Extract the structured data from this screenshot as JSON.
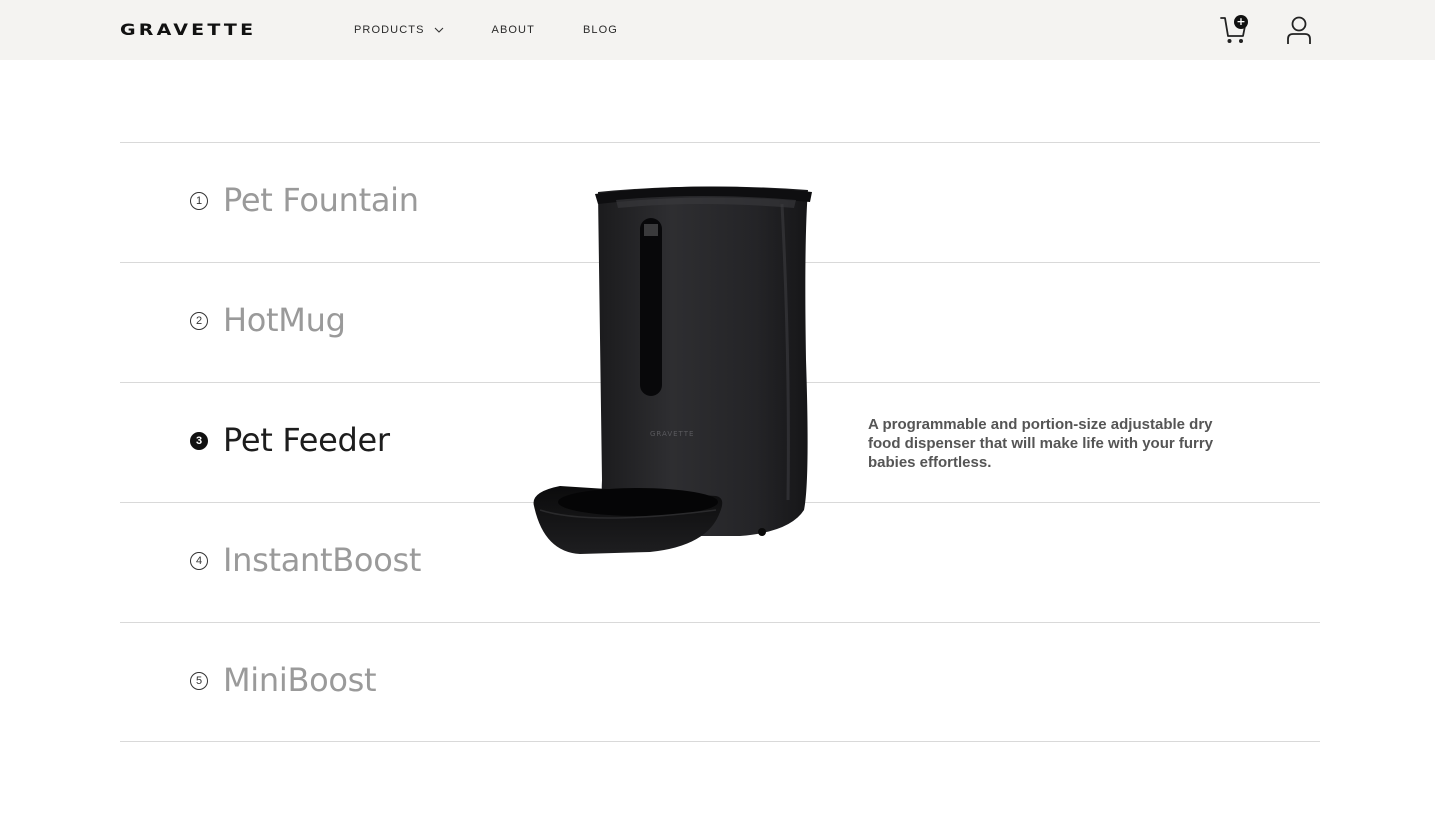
{
  "header": {
    "logo_text": "GRAVETTE",
    "nav": [
      {
        "label": "PRODUCTS"
      },
      {
        "label": "ABOUT"
      },
      {
        "label": "BLOG"
      }
    ],
    "cart_badge": "+"
  },
  "products": [
    {
      "number": "1",
      "name": "Pet Fountain"
    },
    {
      "number": "2",
      "name": "HotMug"
    },
    {
      "number": "3",
      "name": "Pet Feeder",
      "description": "A programmable and portion-size adjustable dry food dispenser that will make life with your furry babies effortless."
    },
    {
      "number": "4",
      "name": "InstantBoost"
    },
    {
      "number": "5",
      "name": "MiniBoost"
    }
  ],
  "active_product": "Pet Feeder",
  "product_image_label": "GRAVETTE",
  "colors": {
    "header_bg": "#f4f3f1",
    "divider": "#d9d9d9",
    "inactive_text": "#9a9a9a",
    "active_text": "#1d1d1d"
  }
}
